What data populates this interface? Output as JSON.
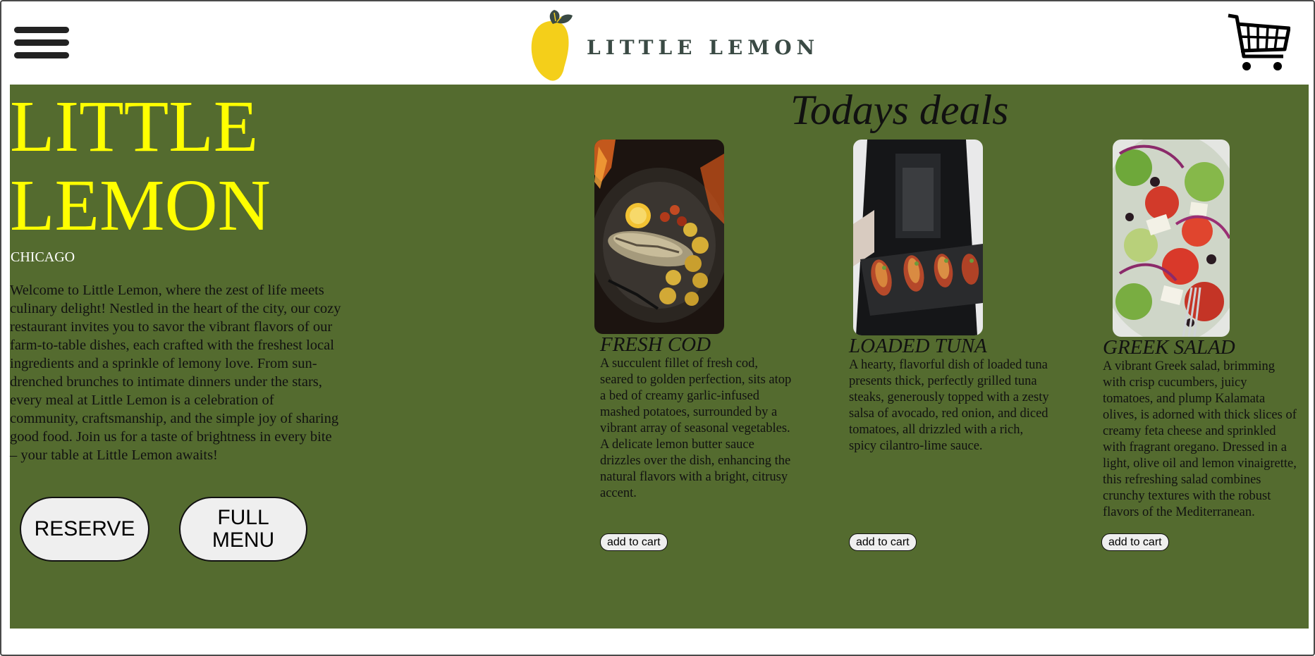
{
  "header": {
    "brand": "LITTLE LEMON"
  },
  "hero": {
    "title_line1": "LITTLE",
    "title_line2": "LEMON",
    "city": "CHICAGO",
    "description": "Welcome to Little Lemon, where the zest of life meets culinary delight! Nestled in the heart of the city, our cozy restaurant invites you to savor the vibrant flavors of our farm-to-table dishes, each crafted with the freshest local ingredients and a sprinkle of lemony love. From sun-drenched brunches to intimate dinners under the stars, every meal at Little Lemon is a celebration of community, craftsmanship, and the simple joy of sharing good food. Join us for a taste of brightness in every bite – your table at Little Lemon awaits!",
    "reserve_label": "RESERVE",
    "menu_label_line1": "FULL",
    "menu_label_line2": "MENU"
  },
  "deals": {
    "title": "Todays deals",
    "items": [
      {
        "name": "FRESH COD",
        "description": "A succulent fillet of fresh cod, seared to golden perfection, sits atop a bed of creamy garlic-infused mashed potatoes, surrounded by a vibrant array of seasonal vegetables. A delicate lemon butter sauce drizzles over the dish, enhancing the natural flavors with a bright, citrusy accent.",
        "button": "add to cart"
      },
      {
        "name": "LOADED TUNA",
        "description": "A hearty, flavorful dish of loaded tuna presents thick, perfectly grilled tuna steaks, generously topped with a zesty salsa of avocado, red onion, and diced tomatoes, all drizzled with a rich, spicy cilantro-lime sauce.",
        "button": "add to cart"
      },
      {
        "name": "GREEK SALAD",
        "description": "A vibrant Greek salad, brimming with crisp cucumbers, juicy tomatoes, and plump Kalamata olives, is adorned with thick slices of creamy feta cheese and sprinkled with fragrant oregano. Dressed in a light, olive oil and lemon vinaigrette, this refreshing salad combines crunchy textures with the robust flavors of the Mediterranean.",
        "button": "add to cart"
      }
    ]
  },
  "colors": {
    "main_bg": "#546b2f",
    "accent_yellow": "#ffff00",
    "lemon": "#f4cf1a",
    "logo_text": "#3a4a44"
  },
  "icons": [
    "hamburger-menu-icon",
    "lemon-logo-icon",
    "shopping-cart-icon"
  ]
}
